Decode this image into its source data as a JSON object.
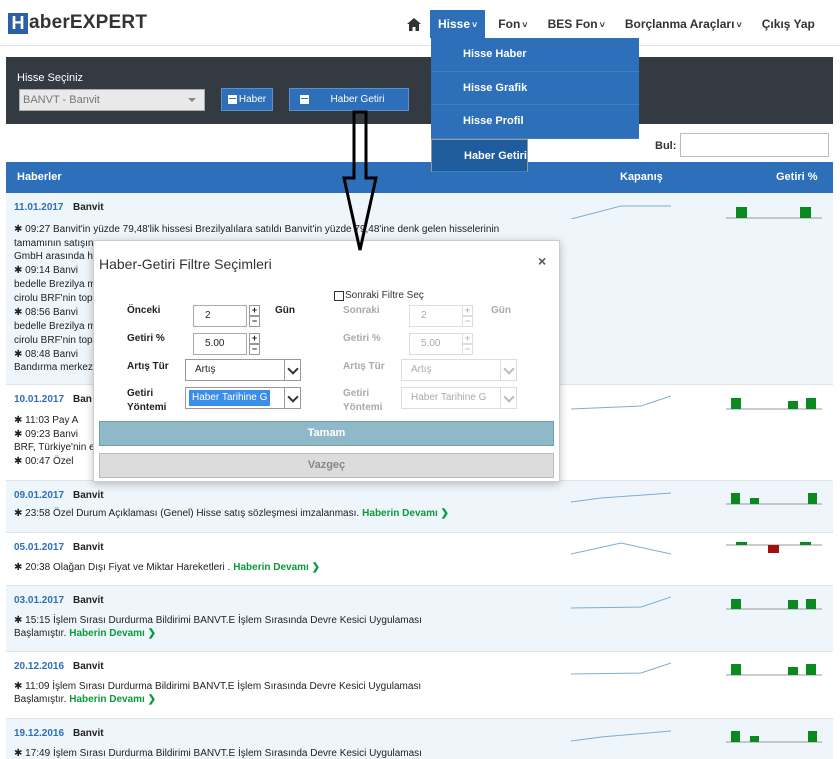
{
  "brand": {
    "h": "H",
    "rest": "aberEXPERT"
  },
  "nav": {
    "items": [
      {
        "label": "Hisse",
        "active": true
      },
      {
        "label": "Fon"
      },
      {
        "label": "BES Fon"
      },
      {
        "label": "Borçlanma Araçları"
      },
      {
        "label": "Çıkış Yap"
      }
    ],
    "dropdown": [
      "Hisse Haber",
      "Hisse Grafik",
      "Hisse Profil",
      "Haber Getiri"
    ]
  },
  "filter": {
    "label": "Hisse Seçiniz",
    "selected": "BANVT - Banvit",
    "btn_haber": "Haber",
    "btn_getiri": "Haber Getiri",
    "search_label": "Bul:"
  },
  "table": {
    "headers": [
      "Haberler",
      "Kapanış",
      "Getiri %"
    ],
    "devam": "Haberin Devamı"
  },
  "rows": [
    {
      "date": "11.01.2017",
      "ticker": "Banvit",
      "lines": [
        "✱ 09:27 Banvit'in yüzde 79,48'lik hissesi Brezilyalılara satıldı Banvit'in yüzde 79,48'ine denk gelen hisselerinin",
        "tamamının satışın",
        "GmbH arasında hi",
        "✱ 09:14 Banvi",
        "bedelle Brezilya m",
        "cirolu BRF'nin topl",
        "✱ 08:56 Banvi",
        "bedelle Brezilya m",
        "cirolu BRF'nin topl",
        "✱ 08:48 Banvi",
        "Bandırma merkezl"
      ]
    },
    {
      "date": "10.01.2017",
      "ticker": "Ban",
      "lines": [
        "✱ 11:03 Pay A",
        "✱ 09:23 Banvi",
        "BRF, Türkiye'nin e",
        "✱ 00:47 Özel"
      ]
    },
    {
      "date": "09.01.2017",
      "ticker": "Banvit",
      "lines": [
        "✱ 23:58 Özel Durum Açıklaması (Genel) Hisse satış sözleşmesi imzalanması."
      ]
    },
    {
      "date": "05.01.2017",
      "ticker": "Banvit",
      "lines": [
        "✱ 20:38 Olağan Dışı Fiyat ve Miktar Hareketleri ."
      ]
    },
    {
      "date": "03.01.2017",
      "ticker": "Banvit",
      "lines": [
        "✱ 15:15 İşlem Sırası Durdurma Bildirimi BANVT.E İşlem Sırasında Devre Kesici Uygulaması",
        "Başlamıştır."
      ]
    },
    {
      "date": "20.12.2016",
      "ticker": "Banvit",
      "lines": [
        "✱ 11:09 İşlem Sırası Durdurma Bildirimi BANVT.E İşlem Sırasında Devre Kesici Uygulaması",
        "Başlamıştır."
      ]
    },
    {
      "date": "19.12.2016",
      "ticker": "Banvit",
      "lines": [
        "✱ 17:49 İşlem Sırası Durdurma Bildirimi BANVT.E İşlem Sırasında Devre Kesici Uygulaması"
      ]
    }
  ],
  "modal": {
    "title": "Haber-Getiri Filtre Seçimleri",
    "close": "×",
    "sonraki_check": "Sonraki Filtre Seç",
    "onceki_label": "Önceki",
    "onceki_value": "2",
    "gun": "Gün",
    "getiri_label": "Getiri %",
    "getiri_value": "5.00",
    "artis_label": "Artış Tür",
    "artis_value": "Artış",
    "yontem_label_1": "Getiri",
    "yontem_label_2": "Yöntemi",
    "yontem_value": "Haber Tarihine G",
    "sonraki_label": "Sonraki",
    "sonraki_value": "2",
    "s_gun": "Gün",
    "s_getiri_label": "Getiri %",
    "s_getiri_value": "5.00",
    "s_artis_label": "Artış Tür",
    "s_artis_value": "Artış",
    "s_yontem_label_1": "Getiri",
    "s_yontem_label_2": "Yöntemi",
    "s_yontem_value": "Haber Tarihine G",
    "tamam": "Tamam",
    "vazgec": "Vazgeç"
  },
  "colors": {
    "brand_blue": "#2d6fb8",
    "bar_green": "#0a8a1e",
    "bar_red": "#a01010",
    "devam_green": "#0a9a3a"
  }
}
